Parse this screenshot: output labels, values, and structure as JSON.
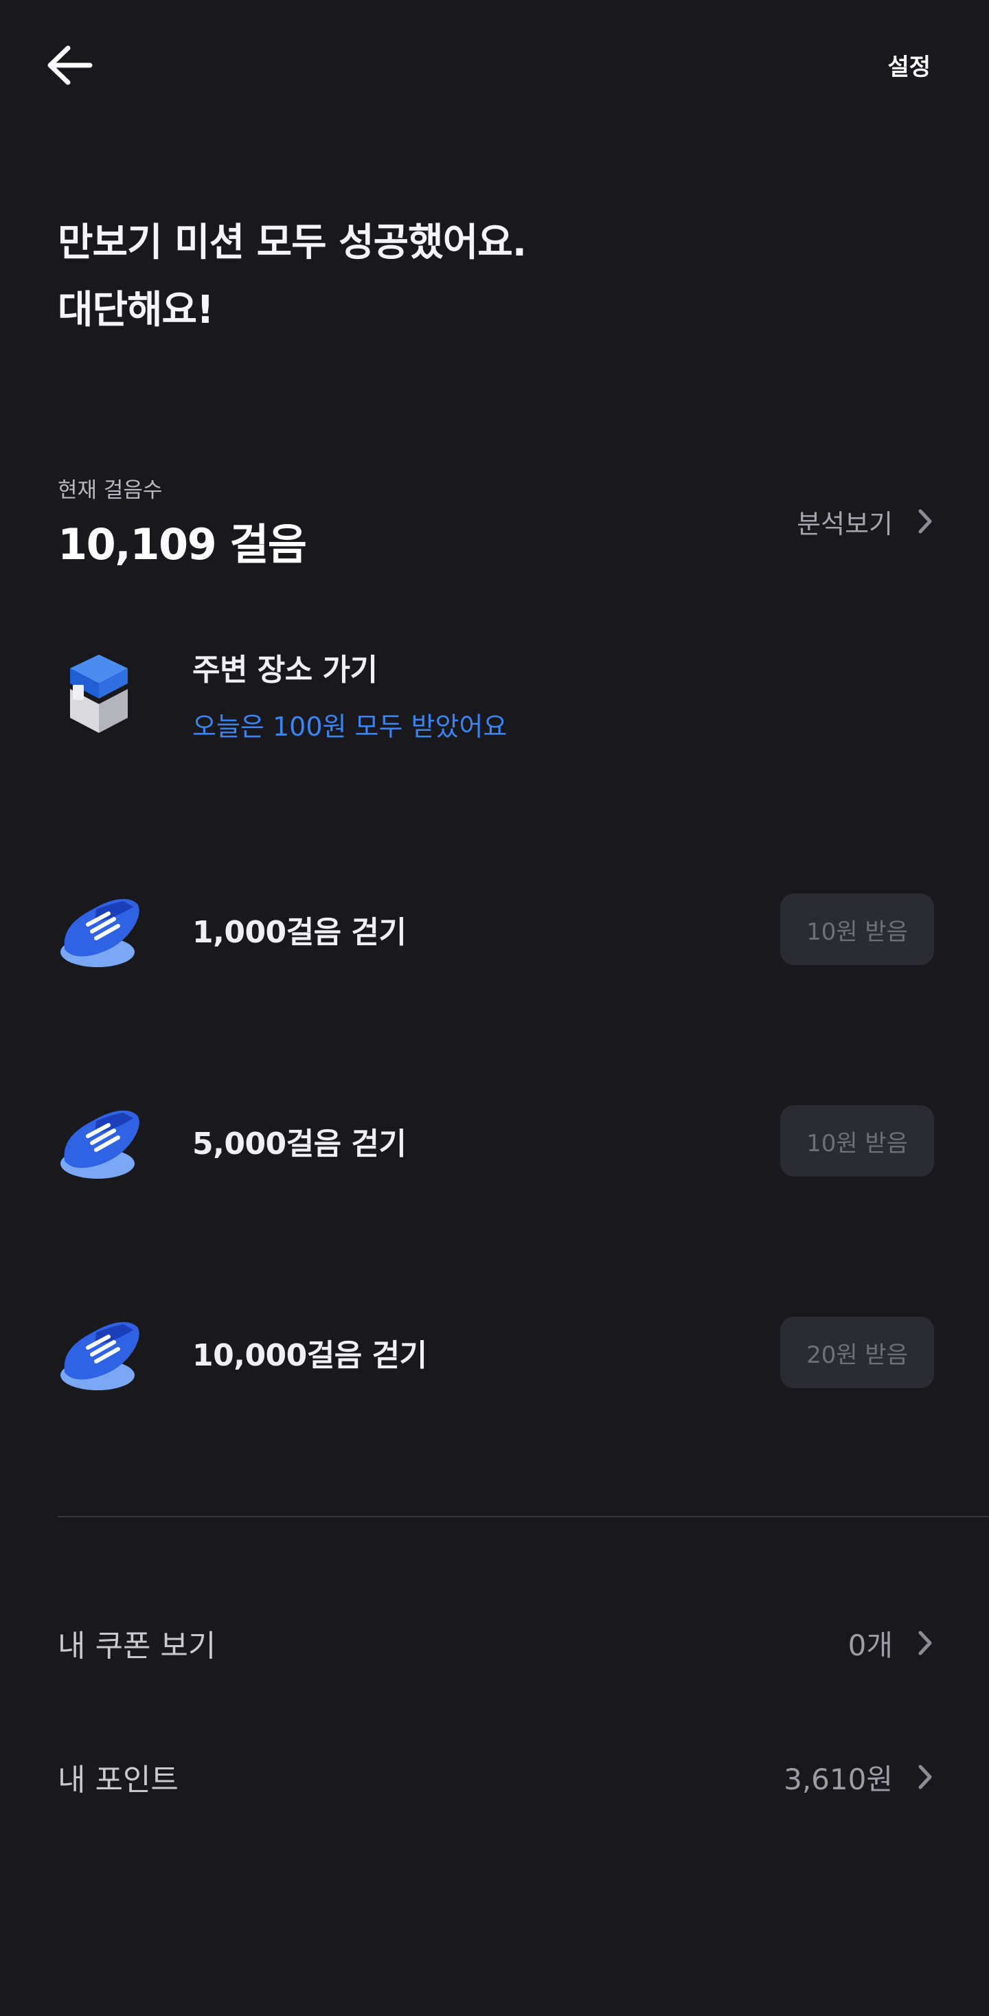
{
  "header": {
    "settings_label": "설정"
  },
  "headline": {
    "line1": "만보기 미션 모두 성공했어요.",
    "line2": "대단해요!"
  },
  "steps": {
    "label": "현재 걸음수",
    "value": "10,109 걸음",
    "analysis_label": "분석보기"
  },
  "missions": [
    {
      "title": "주변 장소 가기",
      "subtitle": "오늘은 100원 모두 받았어요",
      "icon": "building-icon"
    },
    {
      "title": "1,000걸음 걷기",
      "reward": "10원 받음",
      "icon": "shoe-icon"
    },
    {
      "title": "5,000걸음 걷기",
      "reward": "10원 받음",
      "icon": "shoe-icon"
    },
    {
      "title": "10,000걸음 걷기",
      "reward": "20원 받음",
      "icon": "shoe-icon"
    }
  ],
  "rows": {
    "coupon": {
      "label": "내 쿠폰 보기",
      "value": "0개"
    },
    "points": {
      "label": "내 포인트",
      "value": "3,610원"
    }
  },
  "colors": {
    "background": "#18181d",
    "accent": "#3b84f2",
    "button_bg": "#2a2b33"
  }
}
